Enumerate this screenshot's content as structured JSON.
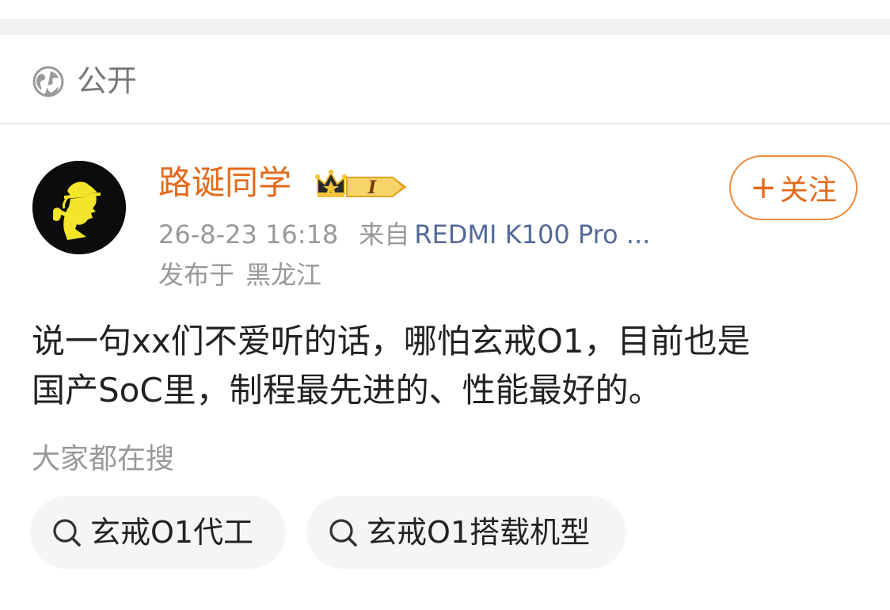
{
  "visibility": {
    "label": "公开",
    "icon": "globe-icon"
  },
  "post": {
    "author": {
      "name": "路诞同学",
      "badge_level": "I",
      "avatar_icon": "detective-avatar"
    },
    "timestamp": "26-8-23 16:18",
    "source_prefix": "来自",
    "device": "REDMI K100 Pro ...",
    "location_prefix": "发布于",
    "location": "黑龙江",
    "follow_label": "关注",
    "follow_plus": "+",
    "content_line1": "说一句xx们不爱听的话，哪怕玄戒O1，目前也是",
    "content_line2": "国产SoC里，制程最先进的、性能最好的。"
  },
  "hot_search": {
    "title": "大家都在搜",
    "items": [
      {
        "label": "玄戒O1代工",
        "icon": "search-icon"
      },
      {
        "label": "玄戒O1搭载机型",
        "icon": "search-icon"
      }
    ]
  },
  "colors": {
    "accent": "#e36a1a",
    "link": "#546a9a",
    "muted": "#999999"
  }
}
